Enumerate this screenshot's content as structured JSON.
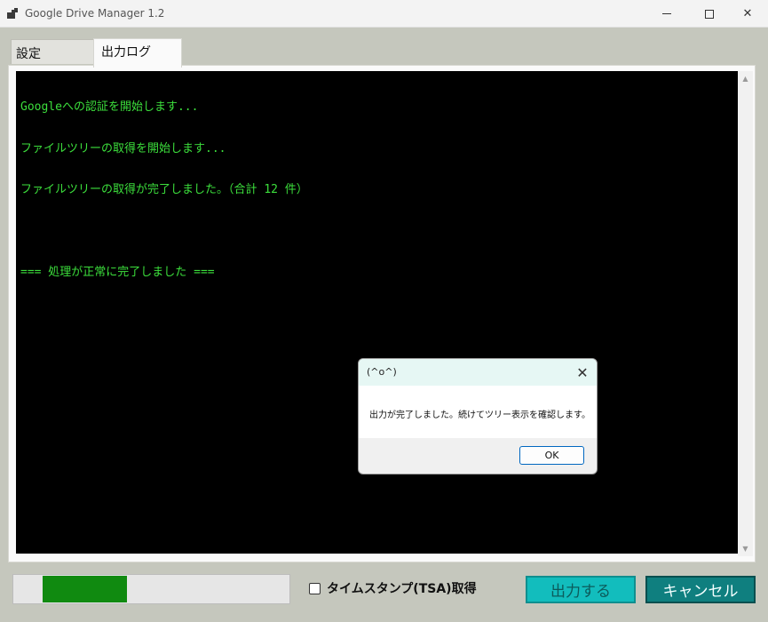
{
  "window": {
    "title": "Google Drive Manager 1.2",
    "minimize_label": "",
    "maximize_label": "",
    "close_label": "✕"
  },
  "tabs": [
    {
      "label": "設定",
      "selected": false
    },
    {
      "label": "出力ログ",
      "selected": true
    }
  ],
  "console": {
    "text_color": "#3cdf3c",
    "background": "#000000",
    "lines": [
      "Googleへの認証を開始します...",
      "ファイルツリーの取得を開始します...",
      "ファイルツリーの取得が完了しました。（合計 12 件）",
      "",
      "=== 処理が正常に完了しました ==="
    ]
  },
  "scrollbar": {
    "up_icon": "▲",
    "down_icon": "▼"
  },
  "progress": {
    "value_fraction": 0.41,
    "color": "#108a10"
  },
  "timestamp_option": {
    "label": "タイムスタンプ(TSA)取得",
    "checked": false
  },
  "buttons": {
    "output_label": "出力する",
    "cancel_label": "キャンセル"
  },
  "dialog": {
    "title": "(^o^)",
    "close_icon": "✕",
    "message": "出力が完了しました。続けてツリー表示を確認します。",
    "ok_label": "OK"
  }
}
